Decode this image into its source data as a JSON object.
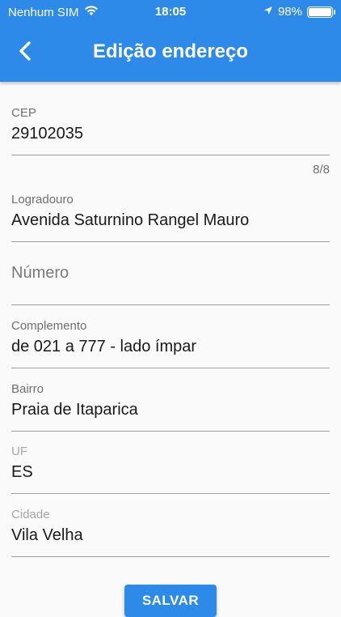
{
  "status_bar": {
    "carrier": "Nenhum SIM",
    "time": "18:05",
    "battery": "98%",
    "battery_level": 0.98
  },
  "toolbar": {
    "title": "Edição endereço"
  },
  "fields": {
    "cep": {
      "label": "CEP",
      "value": "29102035",
      "counter": "8/8"
    },
    "logradouro": {
      "label": "Logradouro",
      "value": "Avenida Saturnino Rangel Mauro"
    },
    "numero": {
      "placeholder": "Número"
    },
    "complemento": {
      "label": "Complemento",
      "value": "de 021 a 777 - lado ímpar"
    },
    "bairro": {
      "label": "Bairro",
      "value": "Praia de Itaparica"
    },
    "uf": {
      "label": "UF",
      "value": "ES"
    },
    "cidade": {
      "label": "Cidade",
      "value": "Vila Velha"
    }
  },
  "actions": {
    "save_label": "SALVAR"
  },
  "colors": {
    "primary": "#2d8ae8",
    "background": "#fafafa",
    "divider": "#9e9e9e"
  }
}
